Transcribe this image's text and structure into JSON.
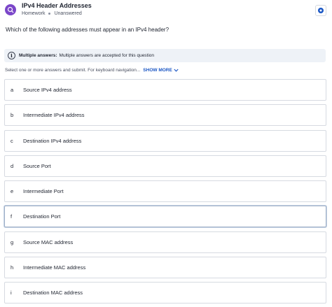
{
  "header": {
    "title": "IPv4 Header Addresses",
    "category": "Homework",
    "status": "Unanswered",
    "app_icon": "chat-search-icon",
    "settings_icon": "gear-icon"
  },
  "question": {
    "text": "Which of the following addresses must appear in an IPv4 header?"
  },
  "banner": {
    "icon": "info-icon",
    "icon_glyph": "i",
    "label": "Multiple answers:",
    "text": "Multiple answers are accepted for this question"
  },
  "instructions": {
    "text": "Select one or more answers and submit. For keyboard navigation...",
    "show_more": "SHOW MORE"
  },
  "options": [
    {
      "letter": "a",
      "text": "Source IPv4 address"
    },
    {
      "letter": "b",
      "text": "Intermediate IPv4 address"
    },
    {
      "letter": "c",
      "text": "Destination IPv4 address"
    },
    {
      "letter": "d",
      "text": "Source Port"
    },
    {
      "letter": "e",
      "text": "Intermediate Port"
    },
    {
      "letter": "f",
      "text": "Destination Port"
    },
    {
      "letter": "g",
      "text": "Source MAC address"
    },
    {
      "letter": "h",
      "text": "Intermediate MAC address"
    },
    {
      "letter": "i",
      "text": "Destination MAC address"
    }
  ],
  "colors": {
    "brand": "#7b46c9",
    "link": "#1a56c4",
    "banner_bg": "#eef2f7"
  }
}
